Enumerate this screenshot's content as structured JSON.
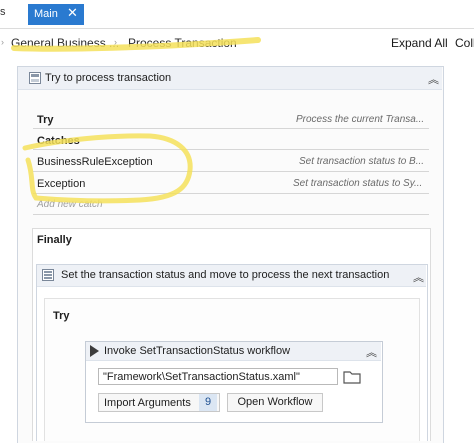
{
  "tabs": {
    "previous_fragment": "s",
    "active_label": "Main",
    "close_glyph": "✕"
  },
  "breadcrumb": {
    "items": [
      "General Business ...",
      "Process Transaction"
    ],
    "separator": "›",
    "lead_arrow": "›"
  },
  "toolbar": {
    "expand_all": "Expand All",
    "collapse_all": "Coll"
  },
  "try_catch": {
    "title": "Try to process transaction",
    "collapse_glyph": "︽",
    "try_label": "Try",
    "try_description": "Process the current Transa...",
    "catches_label": "Catches",
    "catches": [
      {
        "exception": "BusinessRuleException",
        "description": "Set transaction status to B..."
      },
      {
        "exception": "Exception",
        "description": "Set transaction status to Sy..."
      }
    ],
    "add_catch": "Add new catch",
    "finally_label": "Finally"
  },
  "sequence": {
    "title": "Set the transaction status and move to process the next transaction",
    "collapse_glyph": "︽",
    "inner_try_label": "Try"
  },
  "invoke_workflow": {
    "title": "Invoke SetTransactionStatus workflow",
    "collapse_glyph": "︽",
    "workflow_path": "\"Framework\\SetTransactionStatus.xaml\"",
    "import_arguments_label": "Import Arguments",
    "import_arguments_count": "9",
    "open_workflow_label": "Open Workflow"
  },
  "colors": {
    "accent_tab": "#2a7ad0",
    "highlighter": "#f5e15a",
    "header_bg": "#eef1f6"
  },
  "icons": [
    "close-icon",
    "chevron-right-icon",
    "try-catch-icon",
    "collapse-icon",
    "sequence-icon",
    "play-icon",
    "folder-icon"
  ]
}
